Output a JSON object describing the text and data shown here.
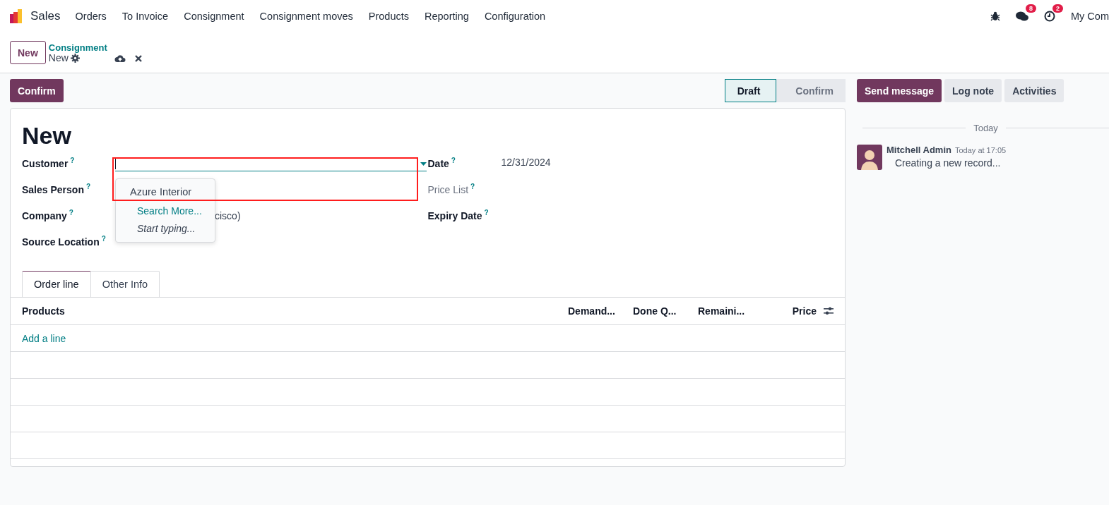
{
  "navbar": {
    "app": "Sales",
    "menu": [
      "Orders",
      "To Invoice",
      "Consignment",
      "Consignment moves",
      "Products",
      "Reporting",
      "Configuration"
    ],
    "messages_badge": "8",
    "activities_badge": "2",
    "company": "My Com"
  },
  "control_panel": {
    "new_button": "New",
    "breadcrumb": "Consignment",
    "record": "New"
  },
  "action_button": "Confirm",
  "statusbar": [
    {
      "label": "Draft",
      "selected": true
    },
    {
      "label": "Confirm",
      "selected": false
    }
  ],
  "form": {
    "title": "New",
    "left_fields": [
      {
        "label": "Customer",
        "help": "?",
        "kind": "input"
      },
      {
        "label": "Sales Person",
        "help": "?",
        "kind": "text"
      },
      {
        "label": "Company",
        "help": "?",
        "kind": "text",
        "value": "cisco)"
      },
      {
        "label": "Source Location",
        "help": "?",
        "kind": "text"
      }
    ],
    "right_fields": [
      {
        "label": "Date",
        "help": "?",
        "value": "12/31/2024",
        "disabled": false
      },
      {
        "label": "Price List",
        "help": "?",
        "disabled": true
      },
      {
        "label": "Expiry Date",
        "help": "?",
        "disabled": false
      }
    ],
    "dropdown": [
      {
        "kind": "option",
        "label": "Azure Interior"
      },
      {
        "kind": "link",
        "label": "Search More..."
      },
      {
        "kind": "hint",
        "label": "Start typing..."
      }
    ],
    "tabs": [
      {
        "label": "Order line",
        "selected": true
      },
      {
        "label": "Other Info",
        "selected": false
      }
    ],
    "columns": [
      "Products",
      "Demand...",
      "Done Q...",
      "Remaini...",
      "Price"
    ],
    "add_line": "Add a line"
  },
  "chatter": {
    "buttons": [
      {
        "label": "Send message",
        "selected": true
      },
      {
        "label": "Log note",
        "selected": false
      },
      {
        "label": "Activities",
        "selected": false
      }
    ],
    "separator": "Today",
    "author": "Mitchell Admin",
    "time": "Today at 17:05",
    "body": "Creating a new record..."
  }
}
